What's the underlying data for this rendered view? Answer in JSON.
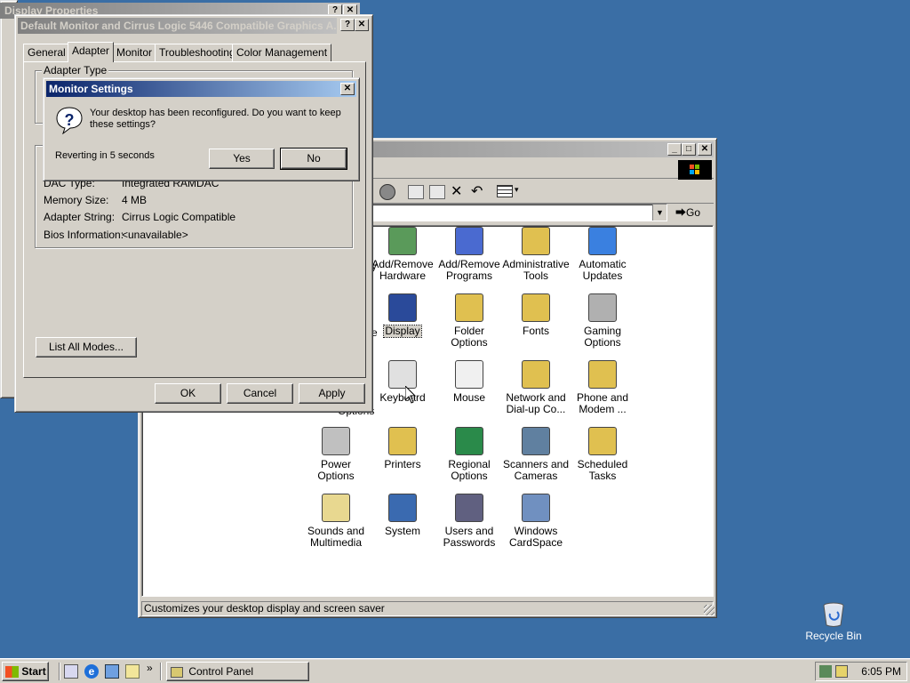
{
  "desktop": {
    "recycle_bin_label": "Recycle Bin",
    "background_color": "#3a6ea5"
  },
  "display_properties": {
    "title": "Display Properties"
  },
  "control_panel": {
    "toolbar_go_label": "Go",
    "status_text": "Customizes your desktop display and screen saver",
    "items": [
      {
        "label": "Add/Remove Hardware",
        "icon": "hardware-icon"
      },
      {
        "label": "Add/Remove Programs",
        "icon": "programs-icon"
      },
      {
        "label": "Administrative Tools",
        "icon": "admin-tools-icon"
      },
      {
        "label": "Automatic Updates",
        "icon": "windows-update-icon"
      },
      {
        "label": "Display",
        "icon": "display-icon",
        "selected": true
      },
      {
        "label": "Folder Options",
        "icon": "folder-options-icon"
      },
      {
        "label": "Fonts",
        "icon": "fonts-icon"
      },
      {
        "label": "Gaming Options",
        "icon": "joystick-icon"
      },
      {
        "label": "Keyboard",
        "icon": "keyboard-icon"
      },
      {
        "label": "Mouse",
        "icon": "mouse-icon"
      },
      {
        "label": "Network and Dial-up Co...",
        "icon": "network-icon"
      },
      {
        "label": "Phone and Modem ...",
        "icon": "phone-icon"
      },
      {
        "label": "Power Options",
        "icon": "power-icon"
      },
      {
        "label": "Printers",
        "icon": "printer-icon"
      },
      {
        "label": "Regional Options",
        "icon": "globe-icon"
      },
      {
        "label": "Scanners and Cameras",
        "icon": "scanner-icon"
      },
      {
        "label": "Scheduled Tasks",
        "icon": "scheduled-tasks-icon"
      },
      {
        "label": "Sounds and Multimedia",
        "icon": "speaker-icon"
      },
      {
        "label": "System",
        "icon": "computer-icon"
      },
      {
        "label": "Users and Passwords",
        "icon": "users-icon"
      },
      {
        "label": "Windows CardSpace",
        "icon": "cardspace-icon"
      }
    ],
    "partial_labels": {
      "top_left": "y",
      "mid_left": "e",
      "low_left": "Options"
    }
  },
  "adapter_dialog": {
    "title": "Default Monitor and Cirrus Logic 5446 Compatible Graphics A...",
    "tabs": [
      "General",
      "Adapter",
      "Monitor",
      "Troubleshooting",
      "Color Management"
    ],
    "active_tab": "Adapter",
    "adapter_type_label": "Adapter Type",
    "info_rows": [
      {
        "label": "DAC Type:",
        "value": "Integrated RAMDAC"
      },
      {
        "label": "Memory Size:",
        "value": "4 MB"
      },
      {
        "label": "Adapter String:",
        "value": "Cirrus Logic Compatible"
      },
      {
        "label": "Bios Information:",
        "value": "<unavailable>"
      }
    ],
    "list_all_modes_label": "List All Modes...",
    "ok_label": "OK",
    "cancel_label": "Cancel",
    "apply_label": "Apply"
  },
  "monitor_settings": {
    "title": "Monitor Settings",
    "message": "Your desktop has been reconfigured.  Do you want to keep these settings?",
    "countdown": "Reverting in 5 seconds",
    "yes_label": "Yes",
    "no_label": "No"
  },
  "taskbar": {
    "start_label": "Start",
    "task_label": "Control Panel",
    "clock": "6:05 PM"
  }
}
